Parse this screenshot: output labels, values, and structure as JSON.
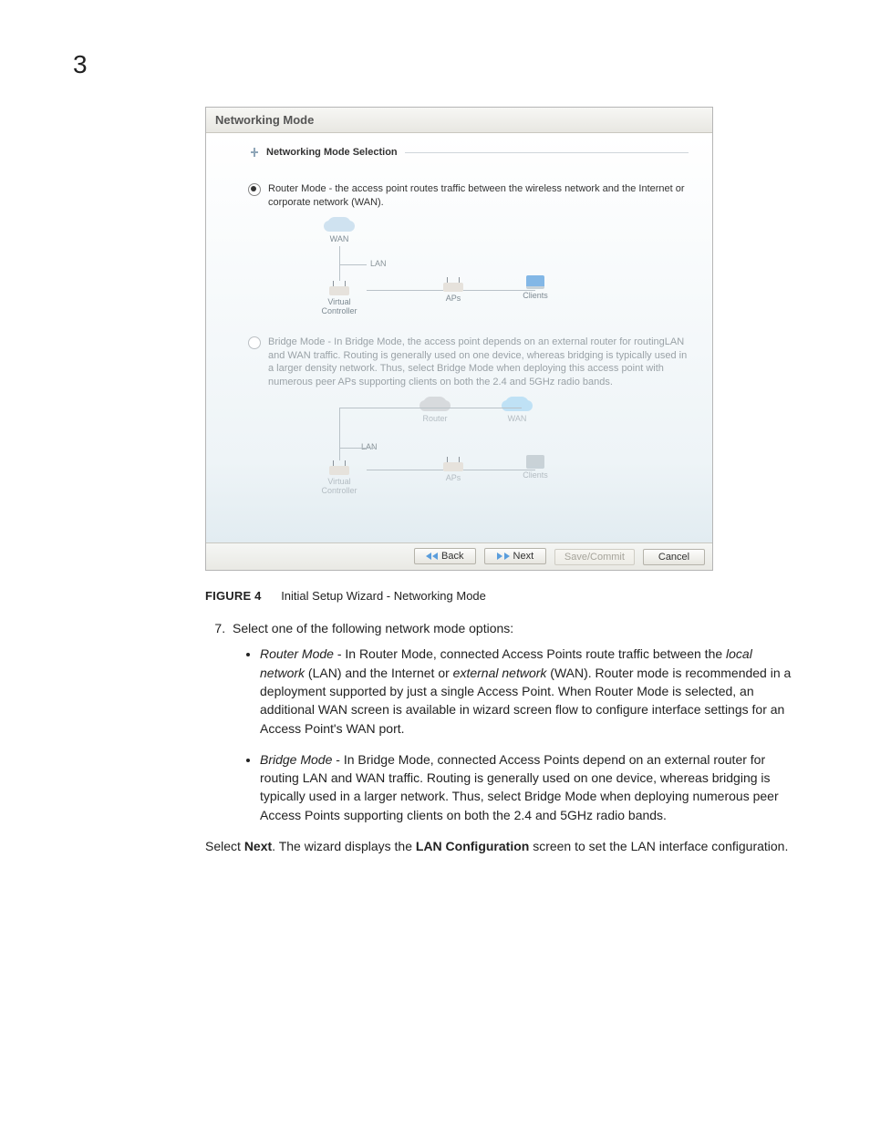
{
  "chapter_number": "3",
  "screenshot": {
    "header": "Networking Mode",
    "fieldset_title": "Networking Mode Selection",
    "options": {
      "router": {
        "text": "Router Mode - the access point routes traffic between the wireless network and the Internet or corporate network (WAN).",
        "diagram": {
          "wan": "WAN",
          "lan": "LAN",
          "vc": "Virtual Controller",
          "aps": "APs",
          "clients": "Clients"
        }
      },
      "bridge": {
        "text": "Bridge Mode - In Bridge Mode, the access point depends on an external router for routingLAN and WAN traffic. Routing is generally used on one device, whereas bridging is typically used in a larger density network. Thus, select Bridge Mode when deploying this access point with numerous peer APs supporting clients on both the 2.4 and 5GHz radio bands.",
        "diagram": {
          "router": "Router",
          "wan": "WAN",
          "lan": "LAN",
          "vc": "Virtual Controller",
          "aps": "APs",
          "clients": "Clients"
        }
      }
    },
    "buttons": {
      "back": "Back",
      "next": "Next",
      "save": "Save/Commit",
      "cancel": "Cancel"
    }
  },
  "figure": {
    "label": "FIGURE 4",
    "caption": "Initial Setup Wizard - Networking Mode"
  },
  "step": {
    "number_start": 7,
    "lead": "Select one of the following network mode options:",
    "router": {
      "name": "Router Mode",
      "pre": " - In Router Mode, connected Access Points route traffic between the ",
      "em1": "local network",
      "mid": " (LAN) and the Internet or ",
      "em2": "external network",
      "post": " (WAN). Router mode is recommended in a deployment supported by just a single Access Point. When Router Mode is selected, an additional WAN screen is available in wizard screen flow to configure interface settings for an Access Point's WAN port."
    },
    "bridge": {
      "name": "Bridge Mode",
      "text": " - In Bridge Mode, connected Access Points depend on an external router for routing LAN and WAN traffic. Routing is generally used on one device, whereas bridging is typically used in a larger network. Thus, select Bridge Mode when deploying numerous peer Access Points supporting clients on both the 2.4 and 5GHz radio bands."
    }
  },
  "closing": {
    "pre": "Select ",
    "b1": "Next",
    "mid": ". The wizard displays the ",
    "b2": "LAN Configuration",
    "post": " screen to set the LAN interface configuration."
  }
}
